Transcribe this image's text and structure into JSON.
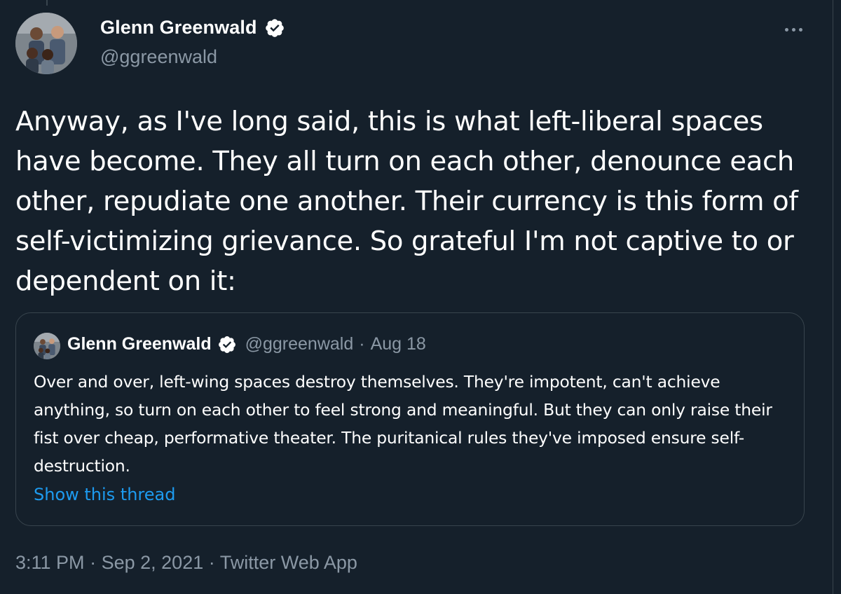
{
  "author": {
    "name": "Glenn Greenwald",
    "handle": "@ggreenwald",
    "avatar_icon": "profile-photo",
    "verified_icon": "verified-badge-icon"
  },
  "tweet": {
    "text": "Anyway, as I've long said, this is what left-liberal spaces have become. They all turn on each other, denounce each other, repudiate one another. Their currency is this form of self-victimizing grievance. So grateful I'm not captive to or dependent on it:",
    "time": "3:11 PM",
    "date": "Sep 2, 2021",
    "source": "Twitter Web App",
    "separator": "·"
  },
  "quoted_tweet": {
    "name": "Glenn Greenwald",
    "handle": "@ggreenwald",
    "separator": "·",
    "date": "Aug 18",
    "text": "Over and over, left-wing spaces destroy themselves. They're impotent, can't achieve anything, so turn on each other to feel strong and meaningful. But they can only raise their fist over cheap, performative theater. The puritanical rules they've imposed ensure self-destruction.",
    "show_thread_label": "Show this thread"
  },
  "colors": {
    "background": "#15202b",
    "text_primary": "#ffffff",
    "text_secondary": "#8b98a5",
    "link": "#1d9bf0",
    "border": "#38444d"
  },
  "more_icon": "more-horizontal-icon"
}
